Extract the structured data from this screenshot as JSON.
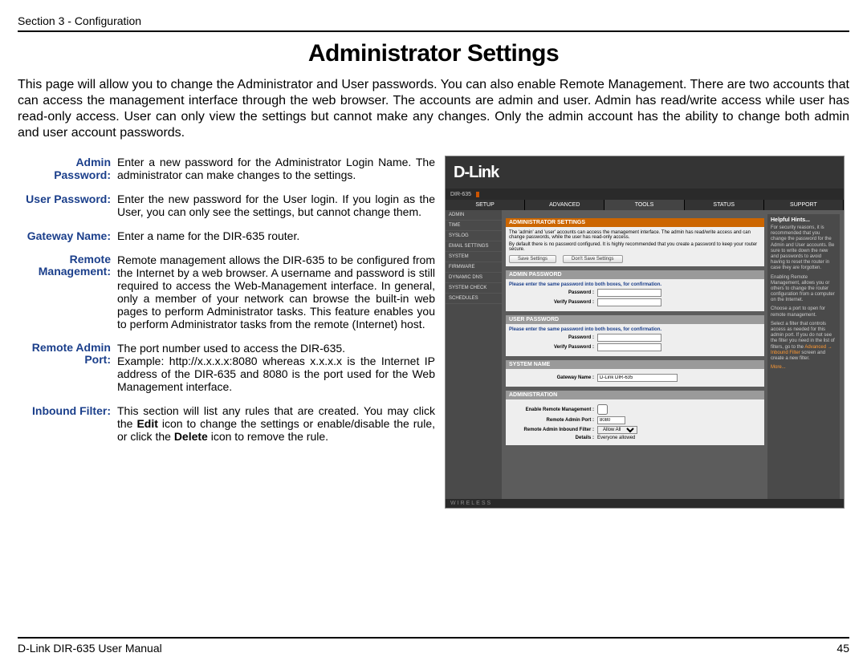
{
  "header": {
    "section": "Section 3 - Configuration"
  },
  "title": "Administrator Settings",
  "intro": "This page will allow you to change the Administrator and User passwords. You can also enable Remote Management. There are two accounts that can access the management interface through the web browser. The accounts are admin and user. Admin has read/write access while user has read-only access. User can only view the settings but cannot make any changes. Only the admin account has the ability to change both admin and user account passwords.",
  "defs": {
    "admin_pw_label": "Admin Password:",
    "admin_pw_body": "Enter a new password for the Administrator Login Name. The administrator can make changes to the settings.",
    "user_pw_label": "User Password:",
    "user_pw_body": "Enter the new password for the User login. If you login as the User, you can only see the settings, but cannot change them.",
    "gw_label": "Gateway Name:",
    "gw_body": "Enter a name for the DIR-635 router.",
    "rm_label": "Remote Management:",
    "rm_body": "Remote management allows the DIR-635 to be configured from the Internet by a web browser. A username and password is still required to access the Web-Management interface. In general, only a member of your network can browse the built-in web pages to perform Administrator tasks. This feature enables you to perform Administrator tasks from the remote (Internet) host.",
    "rap_label": "Remote Admin Port:",
    "rap_body1": "The port number used to access the DIR-635.",
    "rap_body2": "Example: http://x.x.x.x:8080 whereas x.x.x.x is the Internet IP address of the DIR-635 and 8080 is the port used for the Web Management interface.",
    "if_label": "Inbound Filter:",
    "if_body_a": "This section will list any rules that are created. You may click the ",
    "if_body_b": "Edit",
    "if_body_c": " icon to change the settings or enable/disable the rule, or click the ",
    "if_body_d": "Delete",
    "if_body_e": " icon to remove the rule."
  },
  "router": {
    "logo": "D-Link",
    "model": "DIR-635",
    "tabs": [
      "SETUP",
      "ADVANCED",
      "TOOLS",
      "STATUS",
      "SUPPORT"
    ],
    "side": [
      "ADMIN",
      "TIME",
      "SYSLOG",
      "EMAIL SETTINGS",
      "SYSTEM",
      "FIRMWARE",
      "DYNAMIC DNS",
      "SYSTEM CHECK",
      "SCHEDULES"
    ],
    "sect_title": "ADMINISTRATOR SETTINGS",
    "sect_desc1": "The 'admin' and 'user' accounts can access the management interface. The admin has read/write access and can change passwords, while the user has read-only access.",
    "sect_desc2": "By default there is no password configured. It is highly recommended that you create a password to keep your router secure.",
    "btn_save": "Save Settings",
    "btn_dont": "Don't Save Settings",
    "h_admin": "ADMIN PASSWORD",
    "h_user": "USER PASSWORD",
    "h_sys": "SYSTEM NAME",
    "h_adm": "ADMINISTRATION",
    "hint_same": "Please enter the same password into both boxes, for confirmation.",
    "lbl_pw": "Password :",
    "lbl_vpw": "Verify Password :",
    "lbl_gw": "Gateway Name :",
    "lbl_erm": "Enable Remote Management :",
    "lbl_rap": "Remote Admin Port :",
    "lbl_rif": "Remote Admin Inbound Filter :",
    "lbl_det": "Details :",
    "val_gw": "D-Link DIR-635",
    "val_port": "8080",
    "val_filter": "Allow All",
    "val_details": "Everyone allowed",
    "hints_title": "Helpful Hints...",
    "hints_p1": "For security reasons, it is recommended that you change the password for the Admin and User accounts. Be sure to write down the new and passwords to avoid having to reset the router in case they are forgotten.",
    "hints_p2": "Enabling Remote Management, allows you or others to change the router configuration from a computer on the Internet.",
    "hints_p3": "Choose a port to open for remote management.",
    "hints_p4": "Select a filter that controls access as needed for this admin port. If you do not see the filter you need in the list of filters, go to the ",
    "hints_link": "Advanced → Inbound Filter",
    "hints_p4b": " screen and create a new filter.",
    "hints_more": "More...",
    "footer": "WIRELESS"
  },
  "footer": {
    "manual": "D-Link DIR-635 User Manual",
    "page": "45"
  }
}
